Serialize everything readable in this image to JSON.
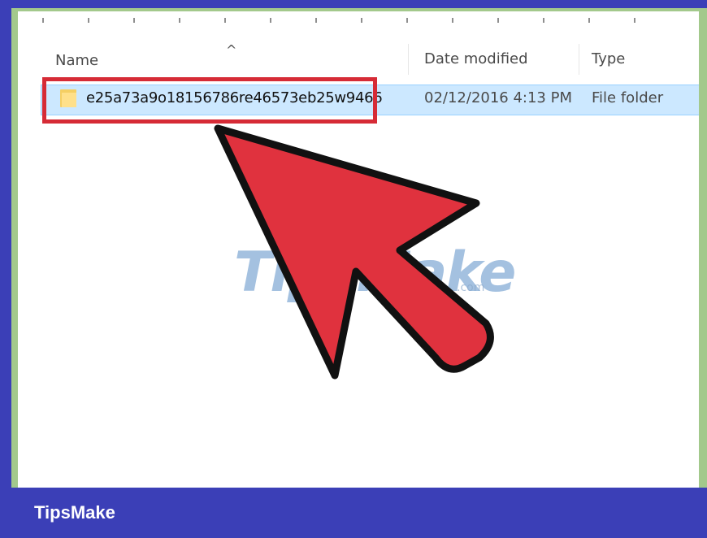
{
  "explorer": {
    "columns": {
      "name": "Name",
      "date_modified": "Date modified",
      "type": "Type"
    },
    "rows": [
      {
        "name": "e25a73a9o18156786re46573eb25w9466",
        "date_modified": "02/12/2016 4:13 PM",
        "type": "File folder",
        "selected": true
      }
    ]
  },
  "watermark": {
    "text": "TipsMake",
    "suffix": ".com"
  },
  "footer": {
    "brand": "TipsMake"
  },
  "colors": {
    "frame_border": "#3b3fb7",
    "highlight": "#d62b36",
    "arrow_fill": "#e0323e",
    "selection": "#cce8ff"
  },
  "icons": {
    "sort": "chevron-up-icon",
    "folder": "folder-icon",
    "pointer": "arrow-cursor-icon"
  }
}
